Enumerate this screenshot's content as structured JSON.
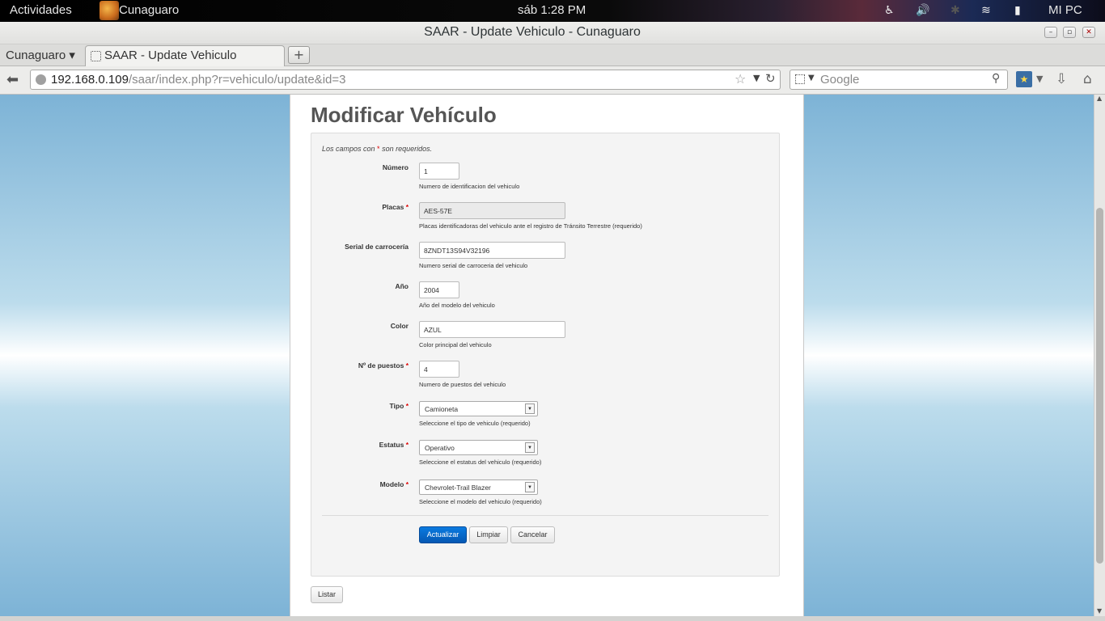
{
  "system_bar": {
    "activities": "Actividades",
    "app_name": "Cunaguaro",
    "clock": "sáb  1:28 PM",
    "user": "MI PC"
  },
  "window": {
    "title": "SAAR - Update Vehiculo - Cunaguaro"
  },
  "tabs": {
    "group": "Cunaguaro ▾",
    "active_tab": "SAAR - Update Vehiculo"
  },
  "navbar": {
    "url_host": "192.168.0.109",
    "url_path": "/saar/index.php?r=vehiculo/update&id=3",
    "search_placeholder": "Google"
  },
  "page": {
    "title": "Modificar Vehículo",
    "note_prefix": "Los campos con ",
    "note_star": "*",
    "note_suffix": " son requeridos."
  },
  "form": {
    "fields": [
      {
        "label": "Número",
        "required": false,
        "value": "1",
        "hint": "Numero de identificacion del vehiculo"
      },
      {
        "label": "Placas",
        "required": true,
        "value": "AES-57E",
        "hint": "Placas identificadoras del vehiculo ante el registro de Tránsito Terrestre (requerido)"
      },
      {
        "label": "Serial de carrocería",
        "required": false,
        "value": "8ZNDT13S94V32196",
        "hint": "Numero serial de carroceria del vehiculo"
      },
      {
        "label": "Año",
        "required": false,
        "value": "2004",
        "hint": "Año del modelo del vehiculo"
      },
      {
        "label": "Color",
        "required": false,
        "value": "AZUL",
        "hint": "Color principal del vehiculo"
      },
      {
        "label": "Nº de puestos",
        "required": true,
        "value": "4",
        "hint": "Numero de puestos del vehiculo"
      },
      {
        "label": "Tipo",
        "required": true,
        "value": "Camioneta",
        "hint": "Seleccione el tipo de vehiculo (requerido)"
      },
      {
        "label": "Estatus",
        "required": true,
        "value": "Operativo",
        "hint": "Seleccione el estatus del vehiculo (requerido)"
      },
      {
        "label": "Modelo",
        "required": true,
        "value": "Chevrolet-Trail Blazer",
        "hint": "Seleccione el modelo del vehiculo (requerido)"
      }
    ],
    "buttons": {
      "update": "Actualizar",
      "clear": "Limpiar",
      "cancel": "Cancelar"
    }
  },
  "list_button": "Listar",
  "colors": {
    "primary_button": "#0a6fd0",
    "required_star": "#dd0000",
    "background_sky": "#7db3d6"
  }
}
